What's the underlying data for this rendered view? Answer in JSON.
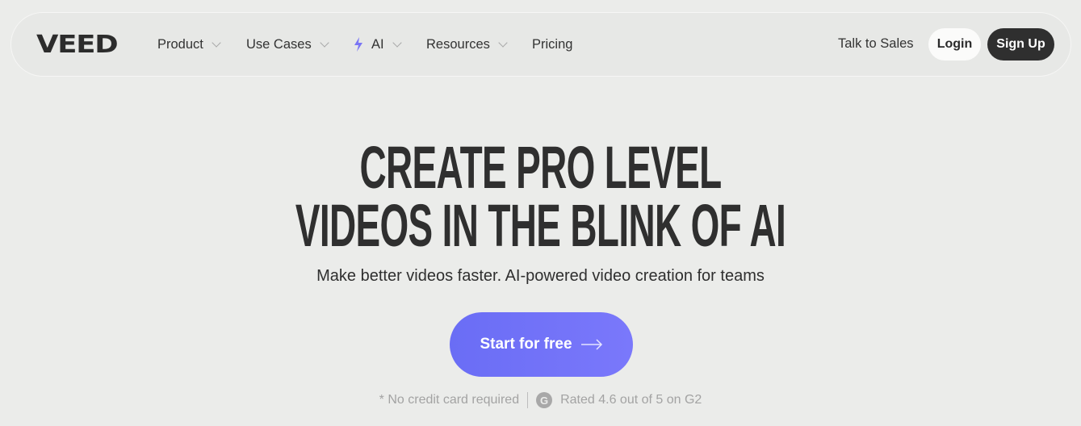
{
  "nav": {
    "logo": "VEED",
    "items": [
      {
        "label": "Product",
        "has_dropdown": true
      },
      {
        "label": "Use Cases",
        "has_dropdown": true
      },
      {
        "label": "AI",
        "has_dropdown": true,
        "icon": "lightning-bolt-icon"
      },
      {
        "label": "Resources",
        "has_dropdown": true
      },
      {
        "label": "Pricing",
        "has_dropdown": false
      }
    ],
    "talk_to_sales": "Talk to Sales",
    "login": "Login",
    "signup": "Sign Up"
  },
  "hero": {
    "headline_line1": "CREATE PRO LEVEL",
    "headline_line2": "VIDEOS IN THE BLINK OF AI",
    "subtitle": "Make better videos faster. AI-powered video creation for teams",
    "cta_label": "Start for free",
    "cta_icon": "arrow-right-icon",
    "footnote_left": "* No credit card required",
    "g2_icon_letter": "G",
    "footnote_right": "Rated 4.6 out of 5 on G2"
  },
  "colors": {
    "background": "#ebecea",
    "text": "#2f2f2f",
    "accent": "#6e70f8",
    "signup_bg": "#2f2f2f",
    "login_bg": "#fbfbfa",
    "muted": "#a3a3a3"
  }
}
